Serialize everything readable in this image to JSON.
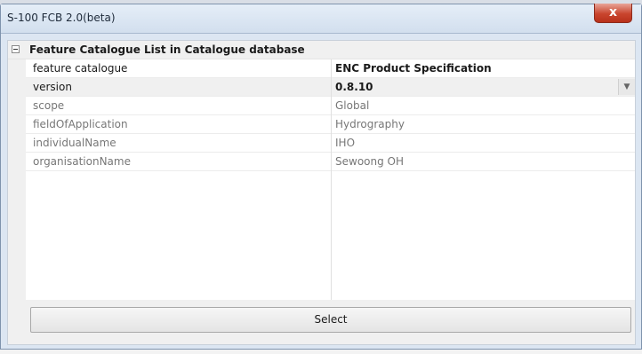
{
  "window": {
    "title": "S-100 FCB 2.0(beta)",
    "close_glyph": "x"
  },
  "grid": {
    "category": {
      "label": "Feature Catalogue List in Catalogue database",
      "expanded": true
    },
    "properties": [
      {
        "name": "feature catalogue",
        "value": "ENC Product Specification"
      },
      {
        "name": "version",
        "value": "0.8.10"
      },
      {
        "name": "scope",
        "value": "Global"
      },
      {
        "name": "fieldOfApplication",
        "value": "Hydrography"
      },
      {
        "name": "individualName",
        "value": "IHO"
      },
      {
        "name": "organisationName",
        "value": "Sewoong OH"
      }
    ]
  },
  "actions": {
    "select_label": "Select"
  },
  "colors": {
    "close_button": "#c9452e",
    "window_frame": "#dce6f2",
    "grid_gutter": "#f0f0f0"
  }
}
